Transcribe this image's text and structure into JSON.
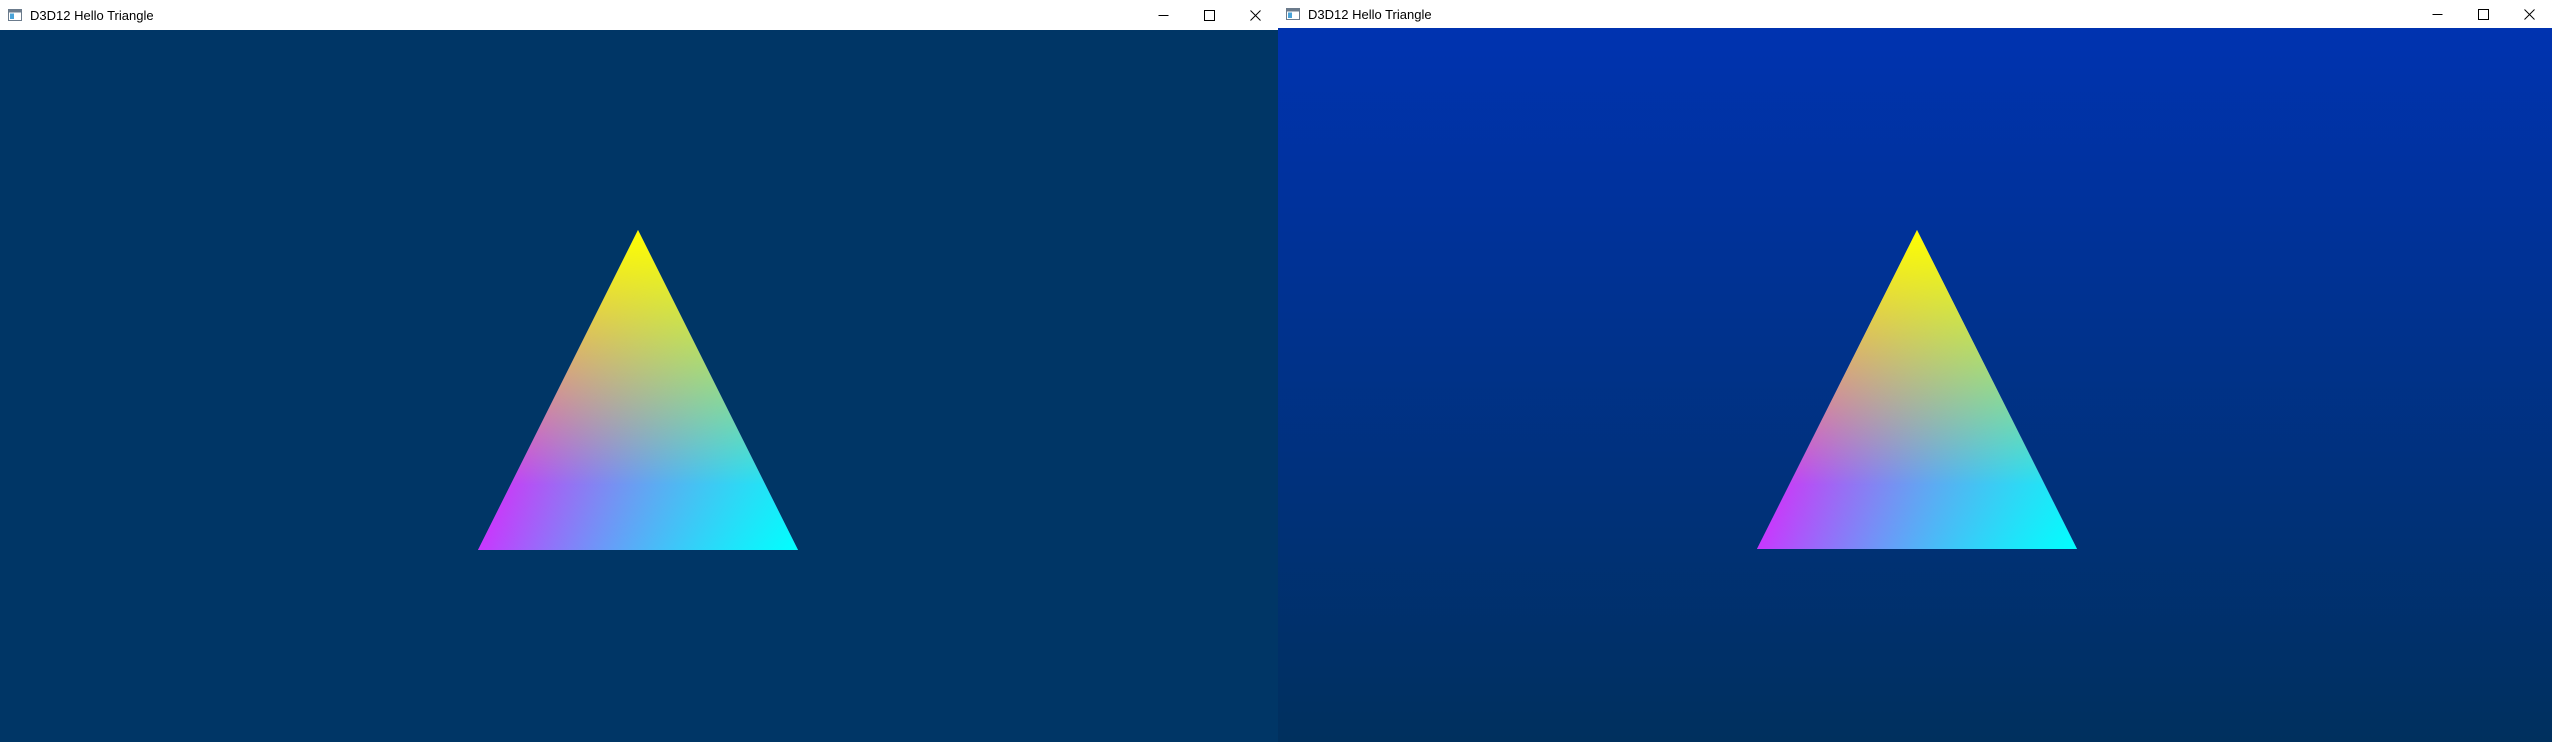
{
  "windows": [
    {
      "title": "D3D12 Hello Triangle",
      "icon": "app-window-icon",
      "controls": [
        "minimize-icon",
        "maximize-icon",
        "close-icon"
      ],
      "clear_color": "#003666"
    },
    {
      "title": "D3D12 Hello Triangle",
      "icon": "app-window-icon",
      "controls": [
        "minimize-icon",
        "maximize-icon",
        "close-icon"
      ],
      "clear_gradient": [
        "#0033b0",
        "#00305e"
      ]
    }
  ],
  "triangle_vertex_colors": {
    "top": "#ffff00",
    "bottom_left": "#ff00ff",
    "bottom_right": "#00ffff"
  }
}
